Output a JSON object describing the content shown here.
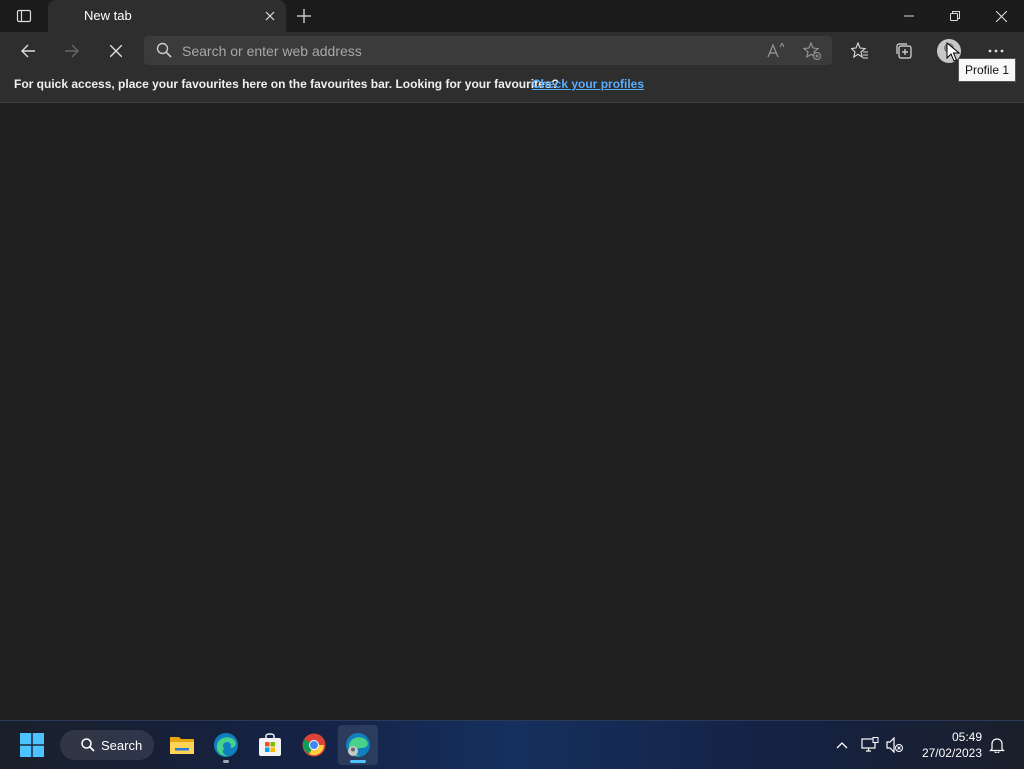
{
  "browser": {
    "tab": {
      "title": "New tab"
    },
    "address_bar": {
      "placeholder": "Search or enter web address",
      "value": ""
    },
    "favourites_bar": {
      "message": "For quick access, place your favourites here on the favourites bar. Looking for your favourites?",
      "link_text": "Check your profiles"
    },
    "profile_tooltip": "Profile 1",
    "toolbar_icons": [
      "back-icon",
      "forward-icon",
      "stop-loading-icon",
      "read-aloud-icon",
      "add-favourite-icon",
      "favourites-icon",
      "collections-icon",
      "profile-avatar-icon",
      "more-icon"
    ]
  },
  "taskbar": {
    "search_label": "Search",
    "apps": [
      "start-icon",
      "file-explorer-icon",
      "edge-icon",
      "microsoft-store-icon",
      "chrome-icon",
      "edge-profile-icon"
    ],
    "clock": {
      "time": "05:49",
      "date": "27/02/2023"
    }
  },
  "colors": {
    "background": "#202020",
    "toolbar": "#2e2e2e",
    "link": "#5aaeff",
    "accent": "#4cc2ff"
  }
}
